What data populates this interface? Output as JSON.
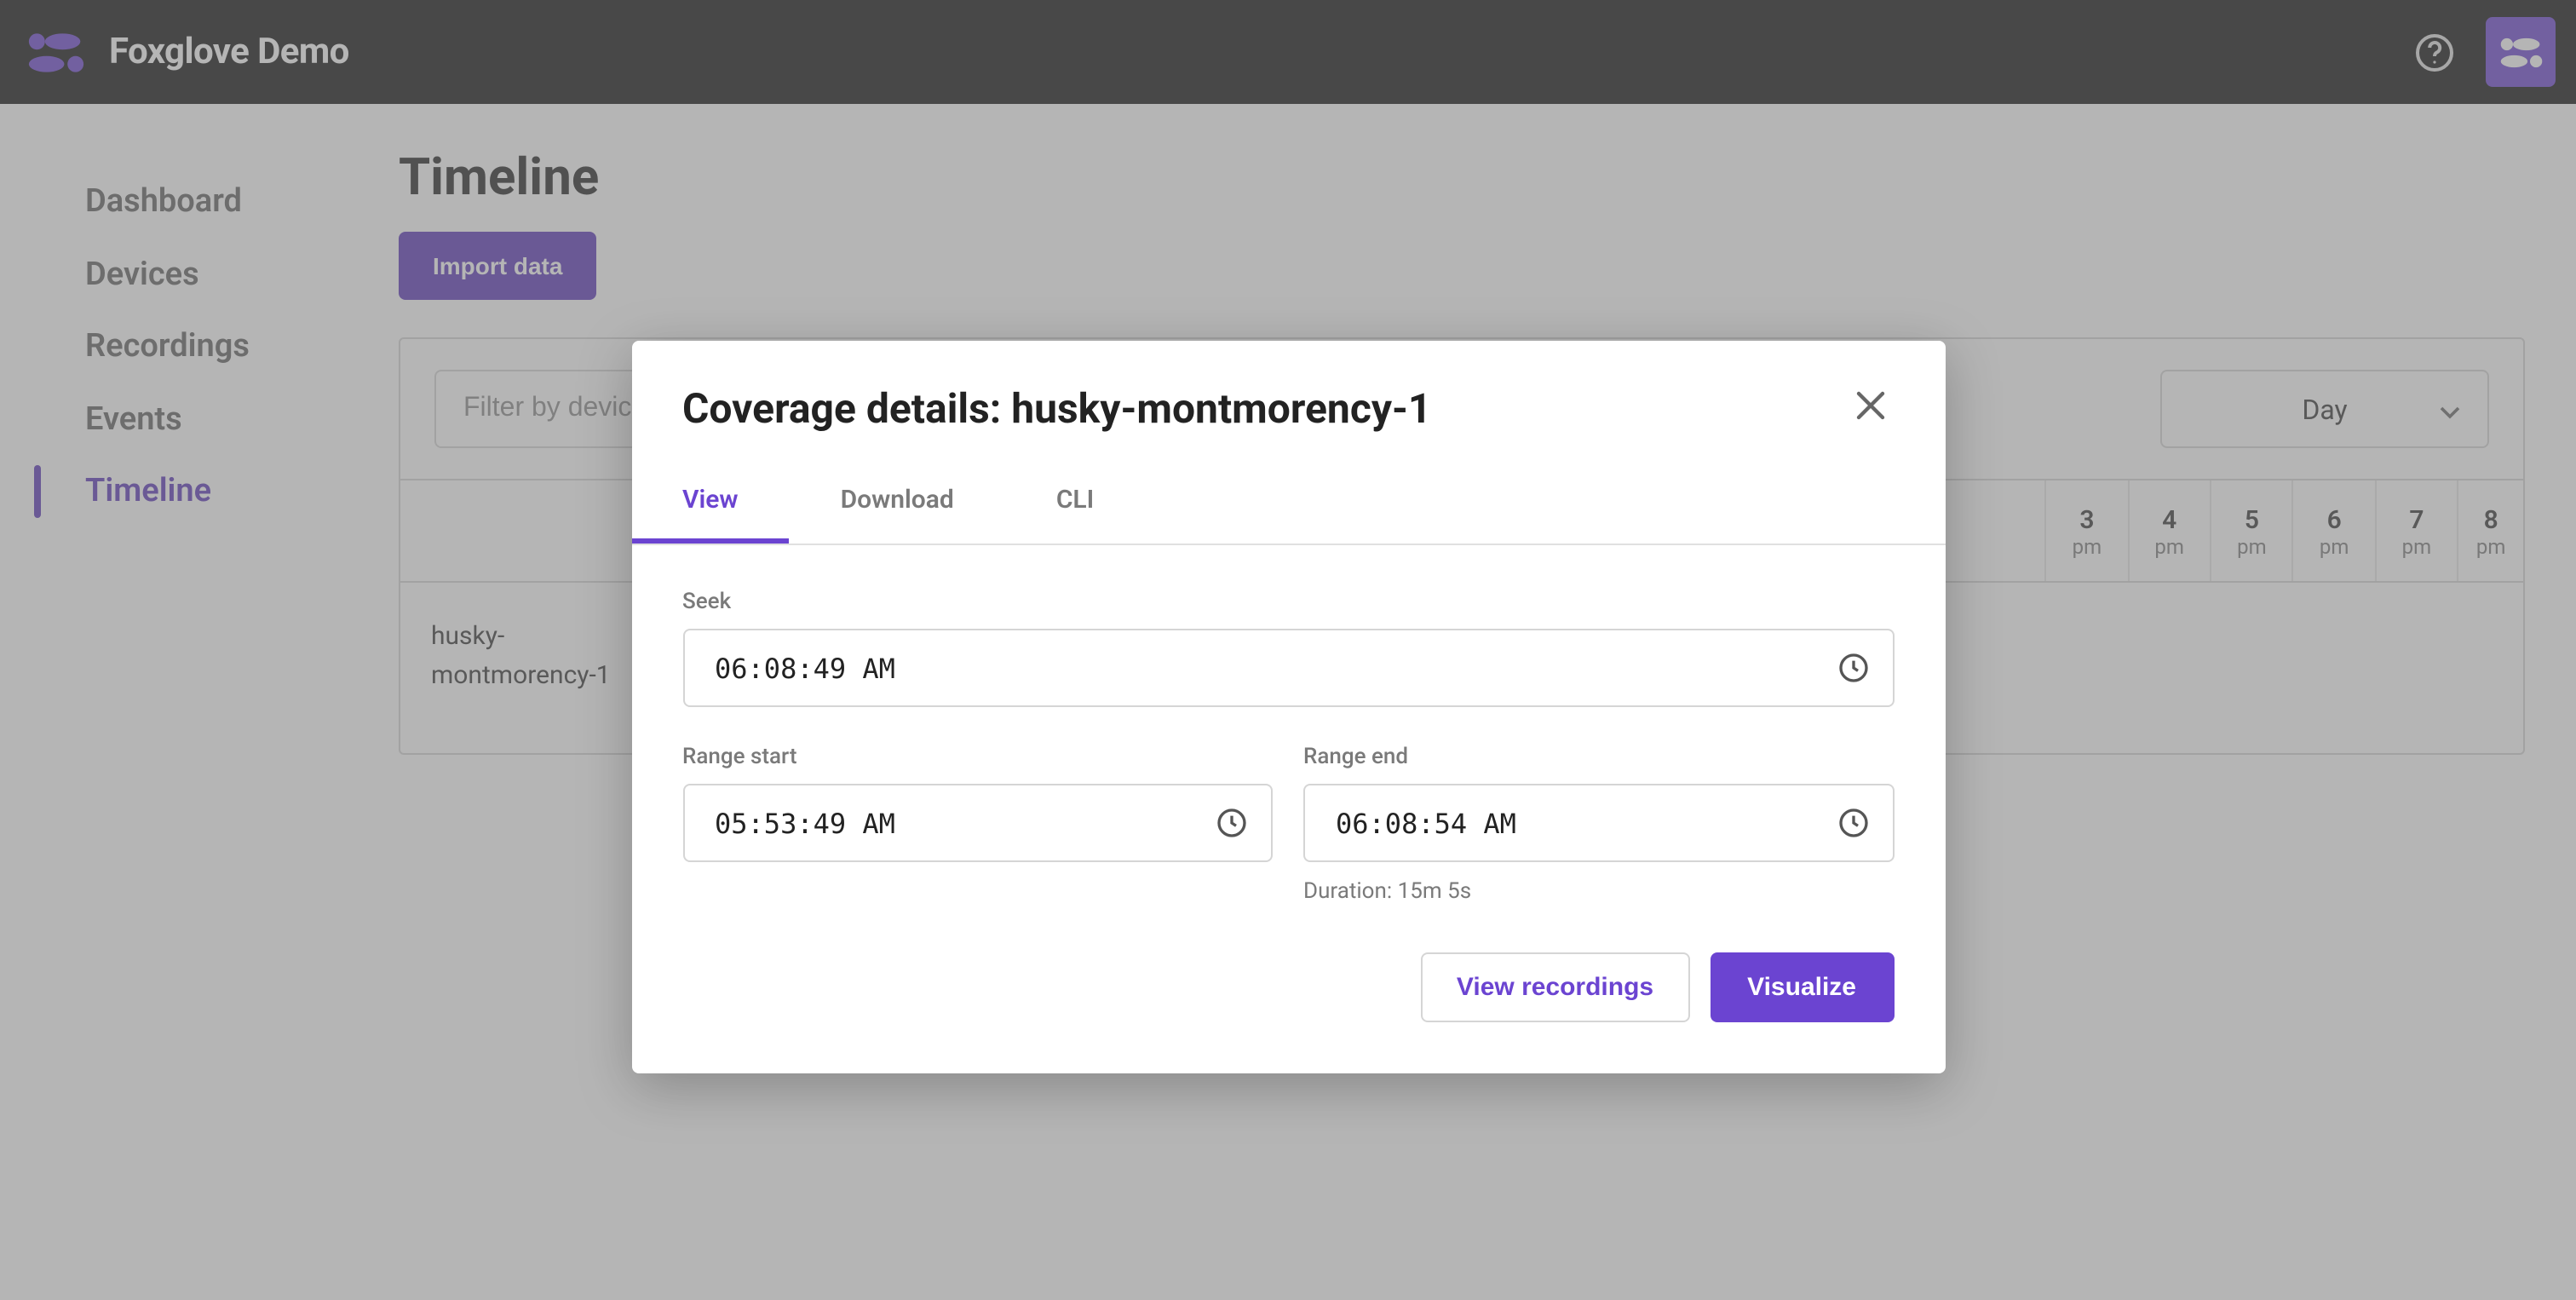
{
  "header": {
    "brand": "Foxglove Demo"
  },
  "sidebar": {
    "items": [
      {
        "label": "Dashboard"
      },
      {
        "label": "Devices"
      },
      {
        "label": "Recordings"
      },
      {
        "label": "Events"
      },
      {
        "label": "Timeline"
      }
    ],
    "active_index": 4
  },
  "page": {
    "title": "Timeline",
    "import_label": "Import data",
    "filter_placeholder": "Filter by device",
    "granularity_label": "Day"
  },
  "timeline": {
    "hours": [
      {
        "num": "3",
        "ampm": "pm"
      },
      {
        "num": "4",
        "ampm": "pm"
      },
      {
        "num": "5",
        "ampm": "pm"
      },
      {
        "num": "6",
        "ampm": "pm"
      },
      {
        "num": "7",
        "ampm": "pm"
      },
      {
        "num": "8",
        "ampm": "pm"
      }
    ],
    "row_device": "husky-montmorency-1"
  },
  "modal": {
    "title": "Coverage details: husky-montmorency-1",
    "tabs": [
      {
        "label": "View"
      },
      {
        "label": "Download"
      },
      {
        "label": "CLI"
      }
    ],
    "active_tab": 0,
    "seek_label": "Seek",
    "seek_value": "06:08:49 AM",
    "range_start_label": "Range start",
    "range_start_value": "05:53:49 AM",
    "range_end_label": "Range end",
    "range_end_value": "06:08:54 AM",
    "duration_text": "Duration: 15m 5s",
    "view_recordings_label": "View recordings",
    "visualize_label": "Visualize"
  }
}
